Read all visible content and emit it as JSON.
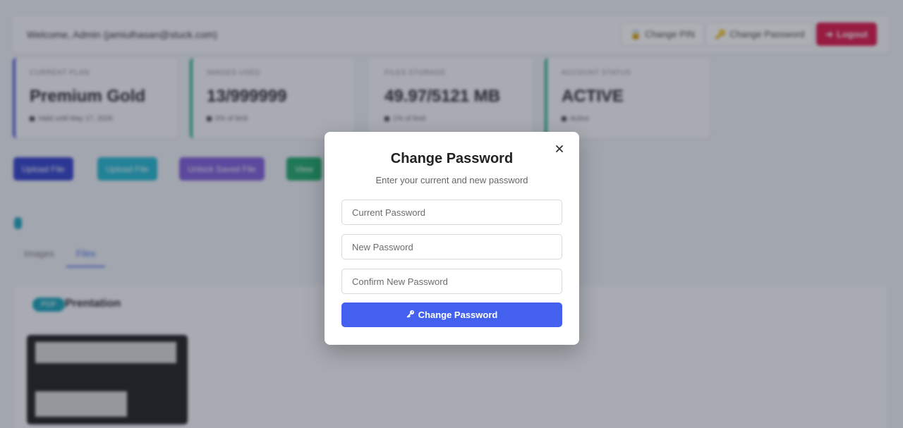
{
  "header": {
    "welcome": "Welcome, Admin (jamiulhasan@stuck.com)",
    "change_pin": "Change PIN",
    "change_password": "Change Password",
    "logout": "Logout"
  },
  "stats": [
    {
      "label": "Current Plan",
      "value": "Premium Gold",
      "sub": "Valid until May 17, 2026",
      "accent": "#4f5bd5"
    },
    {
      "label": "Images Used",
      "value": "13/999999",
      "sub": "0% of limit",
      "accent": "#28b485"
    },
    {
      "label": "Files Storage",
      "value": "49.97/5121 MB",
      "sub": "1% of limit",
      "accent": "#f7f8fb"
    },
    {
      "label": "Account Status",
      "value": "ACTIVE",
      "sub": "Active",
      "accent": "#28b485"
    }
  ],
  "actions": [
    {
      "label": "Upload File",
      "color": "#2f3ec9"
    },
    {
      "label": "Upload File",
      "color": "#1fb6cf"
    },
    {
      "label": "Unlock Saved File",
      "color": "#7c5ad8"
    },
    {
      "label": "View",
      "color": "#1aa866"
    }
  ],
  "tabs": [
    "Images",
    "Files"
  ],
  "files": {
    "badge": "PDF",
    "title": "Prentation"
  },
  "modal": {
    "title": "Change Password",
    "subtitle": "Enter your current and new password",
    "current_placeholder": "Current Password",
    "new_placeholder": "New Password",
    "confirm_placeholder": "Confirm New Password",
    "submit_label": "Change Password"
  }
}
